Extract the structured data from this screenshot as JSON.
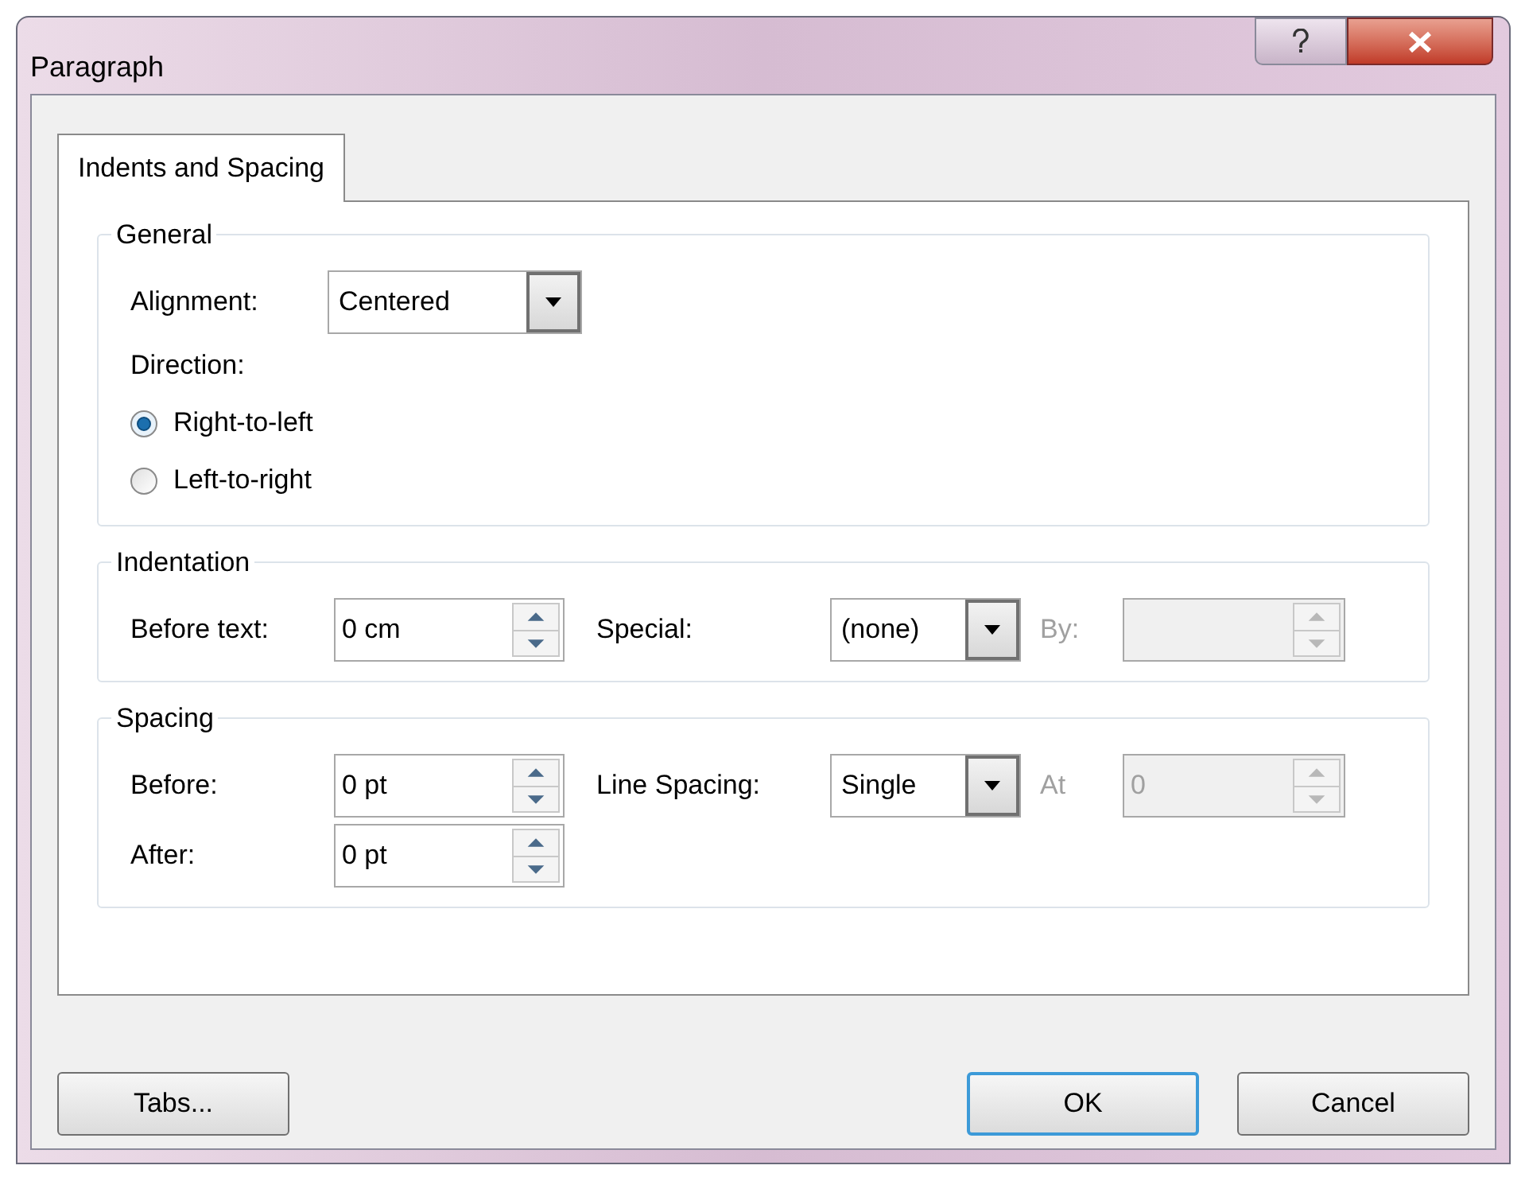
{
  "window": {
    "title": "Paragraph"
  },
  "tabs": [
    {
      "label": "Indents and Spacing",
      "selected": true
    }
  ],
  "groups": [
    {
      "title": "General",
      "rows": [
        [
          {
            "kind": "dropdown",
            "label": "Alignment:",
            "value": "Centered",
            "disabled": false
          }
        ],
        [
          {
            "kind": "heading",
            "label": "Direction:"
          }
        ],
        [
          {
            "kind": "radio",
            "label": "Right-to-left",
            "selected": true
          }
        ],
        [
          {
            "kind": "radio",
            "label": "Left-to-right",
            "selected": false
          }
        ]
      ]
    },
    {
      "title": "Indentation",
      "rows": [
        [
          {
            "kind": "spin",
            "label": "Before text:",
            "value": "0 cm",
            "disabled": false
          },
          {
            "kind": "dropdown",
            "label": "Special:",
            "value": "(none)",
            "disabled": false
          },
          {
            "kind": "spin",
            "label": "By:",
            "disabled": true
          }
        ]
      ]
    },
    {
      "title": "Spacing",
      "rows": [
        [
          {
            "kind": "spin",
            "label": "Before:",
            "value": "0 pt",
            "disabled": false
          },
          {
            "kind": "dropdown",
            "label": "Line Spacing:",
            "value": "Single",
            "disabled": false
          },
          {
            "kind": "spin",
            "label": "At",
            "value": "0",
            "disabled": true
          }
        ],
        [
          {
            "kind": "spin",
            "label": "After:",
            "value": "0 pt",
            "disabled": false
          }
        ]
      ]
    }
  ],
  "buttons": [
    {
      "label": "Tabs...",
      "default": false
    },
    {
      "label": "OK",
      "default": true
    },
    {
      "label": "Cancel",
      "default": false
    }
  ]
}
